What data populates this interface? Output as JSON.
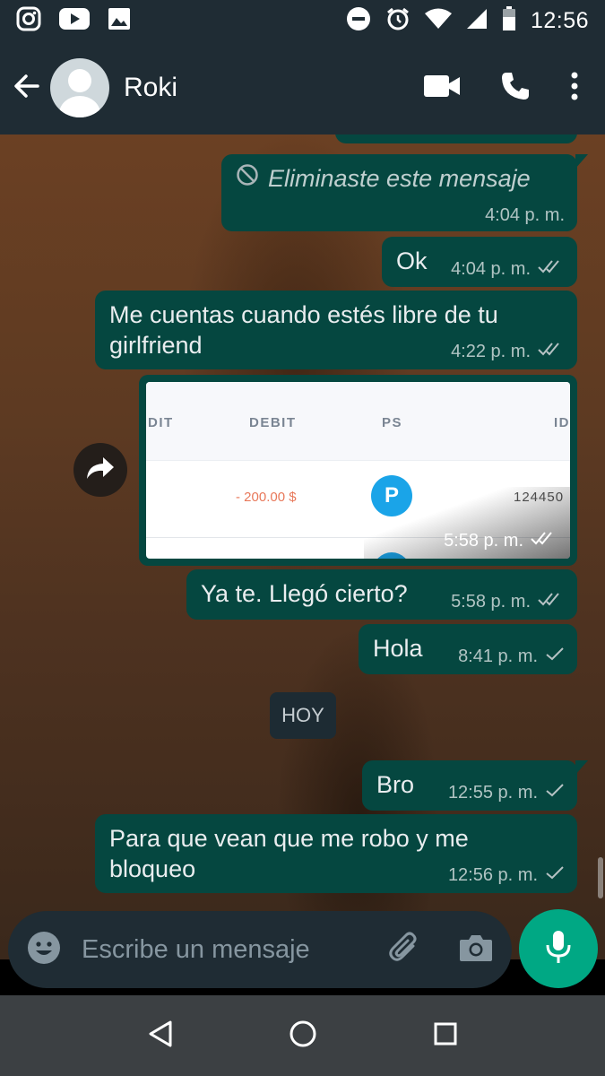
{
  "status_bar": {
    "time": "12:56",
    "left_icons": [
      "instagram-icon",
      "youtube-icon",
      "gallery-icon"
    ],
    "right_icons": [
      "do-not-disturb-icon",
      "alarm-icon",
      "wifi-icon",
      "signal-icon",
      "battery-icon"
    ]
  },
  "header": {
    "contact_name": "Roki",
    "actions": [
      "video-call-icon",
      "voice-call-icon",
      "more-options-icon"
    ]
  },
  "messages": [
    {
      "type": "deleted",
      "text": "Eliminaste este mensaje",
      "time": "4:04 p. m."
    },
    {
      "type": "text",
      "text": "Ok",
      "time": "4:04 p. m.",
      "status": "read"
    },
    {
      "type": "text",
      "text": "Me cuentas cuando estés libre de tu girlfriend",
      "time": "4:22 p. m.",
      "status": "read"
    },
    {
      "type": "image",
      "time": "5:58 p. m.",
      "status": "read",
      "image_content": {
        "headers": [
          "DIT",
          "DEBIT",
          "PS",
          "ID"
        ],
        "amount": "- 200.00 $",
        "badge": "P",
        "id_value": "124450"
      }
    },
    {
      "type": "text",
      "text": "Ya te. Llegó cierto?",
      "time": "5:58 p. m.",
      "status": "read"
    },
    {
      "type": "text",
      "text": "Hola",
      "time": "8:41 p. m.",
      "status": "sent"
    },
    {
      "type": "date",
      "text": "HOY"
    },
    {
      "type": "text",
      "text": "Bro",
      "time": "12:55 p. m.",
      "status": "sent"
    },
    {
      "type": "text",
      "text": "Para que vean que me robo y me bloqueo",
      "time": "12:56 p. m.",
      "status": "sent"
    }
  ],
  "input": {
    "placeholder": "Escribe un mensaje"
  },
  "colors": {
    "bubble_outgoing": "#054740",
    "header_bg": "#1f2c34",
    "accent_green": "#00a884"
  }
}
